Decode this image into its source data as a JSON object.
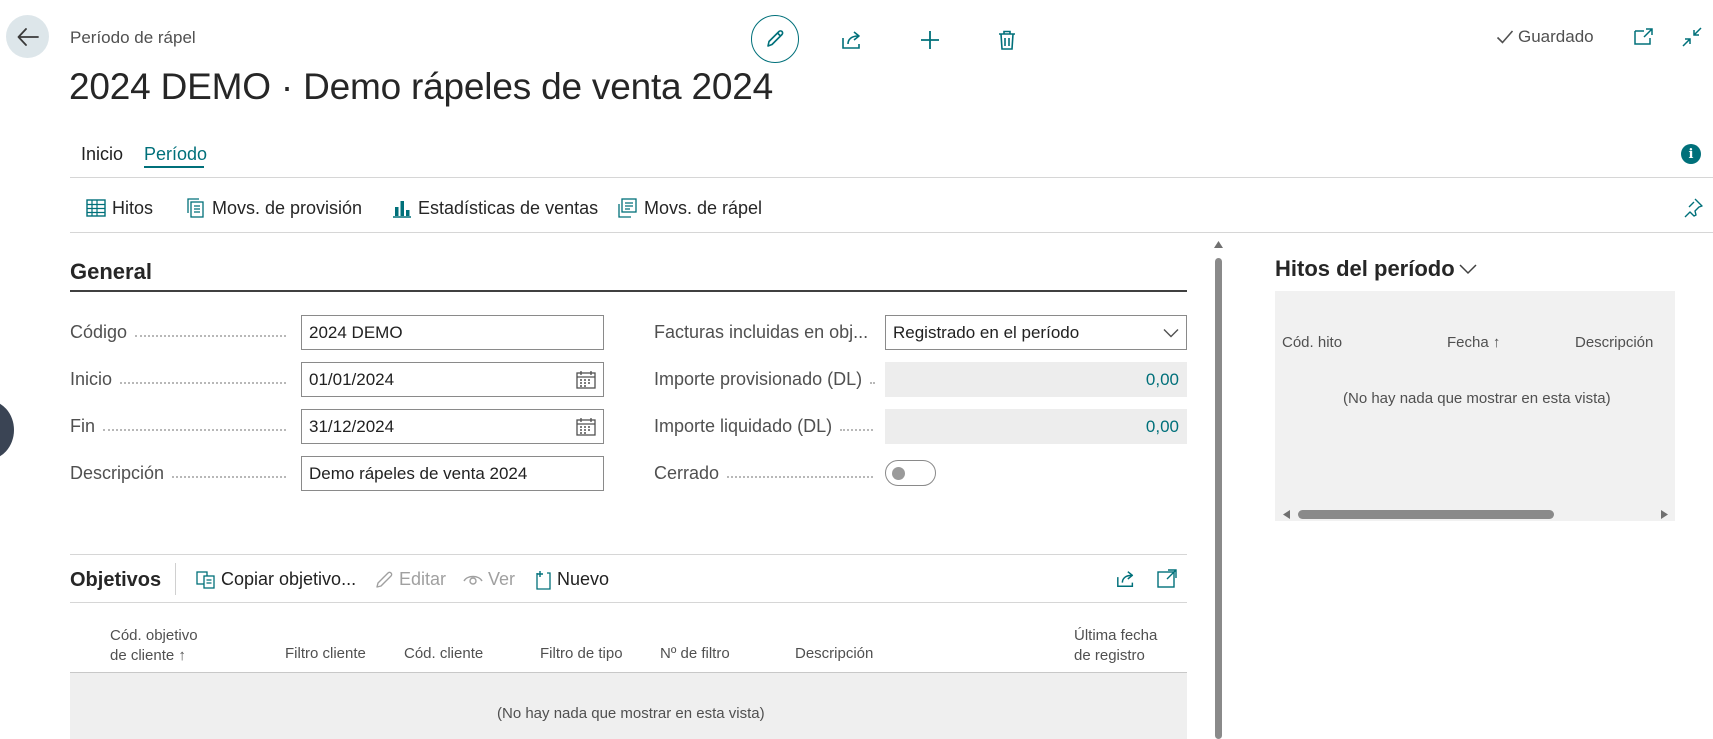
{
  "header": {
    "caption": "Período de rápel",
    "title": "2024 DEMO · Demo rápeles de venta 2024",
    "status": "Guardado"
  },
  "nav": {
    "tabs": [
      {
        "label": "Inicio",
        "active": false
      },
      {
        "label": "Período",
        "active": true
      }
    ]
  },
  "actions": [
    {
      "label": "Hitos",
      "icon": "table-icon"
    },
    {
      "label": "Movs. de provisión",
      "icon": "ledger-entries-icon"
    },
    {
      "label": "Estadísticas de ventas",
      "icon": "statistics-icon"
    },
    {
      "label": "Movs. de rápel",
      "icon": "entries-icon"
    }
  ],
  "general": {
    "title": "General",
    "left_fields": [
      {
        "label": "Código",
        "value": "2024 DEMO"
      },
      {
        "label": "Inicio",
        "value": "01/01/2024"
      },
      {
        "label": "Fin",
        "value": "31/12/2024"
      },
      {
        "label": "Descripción",
        "value": "Demo rápeles de venta 2024"
      }
    ],
    "right_fields": [
      {
        "label": "Facturas incluidas en obj...",
        "value": "Registrado en el período"
      },
      {
        "label": "Importe provisionado (DL)",
        "value": "0,00"
      },
      {
        "label": "Importe liquidado (DL)",
        "value": "0,00"
      },
      {
        "label": "Cerrado",
        "value": "off"
      }
    ]
  },
  "objetivos": {
    "title": "Objetivos",
    "actions": [
      {
        "label": "Copiar objetivo...",
        "enabled": true
      },
      {
        "label": "Editar",
        "enabled": false
      },
      {
        "label": "Ver",
        "enabled": false
      },
      {
        "label": "Nuevo",
        "enabled": true
      }
    ],
    "columns": [
      {
        "line1": "Cód. objetivo",
        "line2": "de cliente ↑"
      },
      {
        "line1": "Filtro cliente",
        "line2": ""
      },
      {
        "line1": "Cód. cliente",
        "line2": ""
      },
      {
        "line1": "Filtro de tipo",
        "line2": ""
      },
      {
        "line1": "Nº de filtro",
        "line2": ""
      },
      {
        "line1": "Descripción",
        "line2": ""
      },
      {
        "line1": "Última fecha",
        "line2": "de registro"
      }
    ],
    "empty_message": "(No hay nada que mostrar en esta vista)"
  },
  "factbox": {
    "title": "Hitos del período",
    "columns": [
      "Cód. hito",
      "Fecha ↑",
      "Descripción"
    ],
    "empty_message": "(No hay nada que mostrar en esta vista)"
  },
  "colors": {
    "accent": "#00707a",
    "readonly_bg": "#ededed",
    "factbox_bg": "#f1f1f1"
  }
}
